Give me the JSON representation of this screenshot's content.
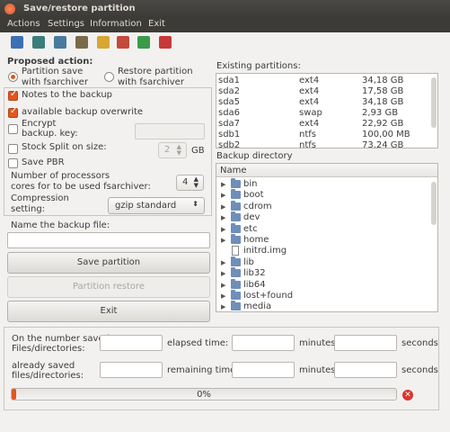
{
  "window": {
    "title": "Save/restore partition"
  },
  "menu": {
    "actions": "Actions",
    "settings": "Settings",
    "information": "Information",
    "exit": "Exit"
  },
  "toolbar": {
    "icons": [
      "save-icon",
      "network-icon",
      "disk-icon",
      "settings-icon",
      "export-icon",
      "import-icon",
      "refresh-icon",
      "help-icon"
    ],
    "colors": [
      "#3c6fb3",
      "#3a7d7a",
      "#4a7a9e",
      "#7a6a4a",
      "#d8a634",
      "#c44a3a",
      "#3a9a4a",
      "#c63a3a"
    ]
  },
  "proposed": {
    "heading": "Proposed action:",
    "save_line1": "Partition save",
    "save_line2": "with fsarchiver",
    "restore_line1": "Restore partition",
    "restore_line2": "with fsarchiver",
    "selected": "save"
  },
  "options": {
    "notes_label": "Notes to  the backup",
    "notes_checked": true,
    "overwrite_label": "available backup overwrite",
    "overwrite_checked": true,
    "encrypt_line1": "Encrypt",
    "encrypt_line2": "backup. key:",
    "encrypt_checked": false,
    "split_label": "Stock Split on size:",
    "split_checked": false,
    "split_value": "2",
    "split_unit": "GB",
    "pbr_label": "Save PBR",
    "pbr_checked": false,
    "cores_line1": "Number of processors",
    "cores_line2": "cores for to be used fsarchiver:",
    "cores_value": "4",
    "compression_line1": "Compression",
    "compression_line2": "setting:",
    "compression_value": "gzip standard"
  },
  "backup_name": {
    "label": "Name the backup file:",
    "value": ""
  },
  "buttons": {
    "save": "Save partition",
    "restore": "Partition restore",
    "exit": "Exit"
  },
  "partitions": {
    "label": "Existing partitions:",
    "rows": [
      {
        "name": "sda1",
        "fs": "ext4",
        "size": "34,18 GB"
      },
      {
        "name": "sda2",
        "fs": "ext4",
        "size": "17,58 GB"
      },
      {
        "name": "sda5",
        "fs": "ext4",
        "size": "34,18 GB"
      },
      {
        "name": "sda6",
        "fs": "swap",
        "size": "2,93 GB"
      },
      {
        "name": "sda7",
        "fs": "ext4",
        "size": "22,92 GB"
      },
      {
        "name": "sdb1",
        "fs": "ntfs",
        "size": "100,00 MB"
      },
      {
        "name": "sdb2",
        "fs": "ntfs",
        "size": "73.24 GB"
      }
    ]
  },
  "directory": {
    "label": "Backup directory",
    "header": "Name",
    "items": [
      {
        "name": "bin",
        "type": "folder"
      },
      {
        "name": "boot",
        "type": "folder"
      },
      {
        "name": "cdrom",
        "type": "folder"
      },
      {
        "name": "dev",
        "type": "folder"
      },
      {
        "name": "etc",
        "type": "folder"
      },
      {
        "name": "home",
        "type": "folder"
      },
      {
        "name": "initrd.img",
        "type": "file"
      },
      {
        "name": "lib",
        "type": "folder"
      },
      {
        "name": "lib32",
        "type": "folder"
      },
      {
        "name": "lib64",
        "type": "folder"
      },
      {
        "name": "lost+found",
        "type": "folder"
      },
      {
        "name": "media",
        "type": "folder"
      }
    ]
  },
  "status": {
    "files_line1": "On the number saved",
    "files_line2": "Files/directories:",
    "saved_line1": "already saved",
    "saved_line2": "files/directories:",
    "elapsed_label": "elapsed time:",
    "remaining_label": "remaining time:",
    "minutes": "minutes",
    "seconds": "seconds",
    "progress_text": "0%",
    "progress_fraction": 0
  },
  "colors": {
    "accent": "#e2561f",
    "titlebar": "#3c3b37",
    "stop": "#d8362d"
  }
}
